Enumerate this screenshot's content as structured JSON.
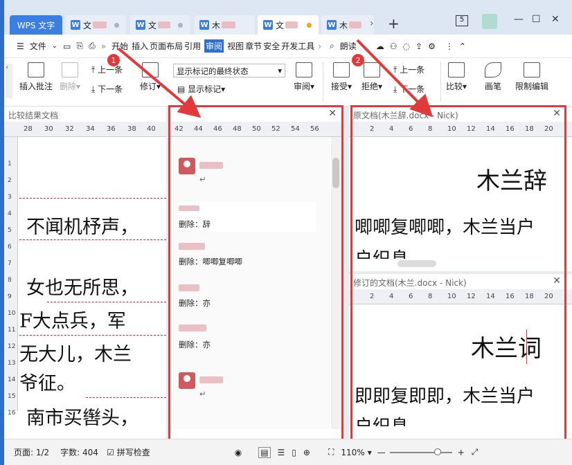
{
  "tabs": {
    "wps": "WPS 文字",
    "doc1": "文",
    "doc2": "文",
    "doc3": "木",
    "doc4": "文",
    "doc5": "木"
  },
  "menu": {
    "file": "文件",
    "items": [
      "开始",
      "插入",
      "页面布局",
      "引用",
      "审阅",
      "视图",
      "章节",
      "安全",
      "开发工具"
    ],
    "selected": "审阅",
    "read_aloud": "朗读"
  },
  "ribbon": {
    "insert_comment": "插入批注",
    "delete": "删除",
    "prev": "上一条",
    "next": "下一条",
    "revise": "修订",
    "show_state": "显示标记的最终状态",
    "show_markup": "显示标记",
    "review": "审阅",
    "accept": "接受",
    "reject": "拒绝",
    "prev2": "上一条",
    "next2": "下一条",
    "compare": "比较",
    "pen": "画笔",
    "restrict": "限制编辑"
  },
  "left_pane": {
    "title": "比较结果文档",
    "ruler": [
      "28",
      "30",
      "32",
      "34",
      "36",
      "38",
      "40"
    ],
    "lines": [
      "不闻机杼声，",
      "女也无所思，",
      "F大点兵，军",
      "无大儿，木兰",
      "爷征。",
      "南市买辔头，"
    ],
    "vruler": [
      "1",
      "2",
      "3",
      "4",
      "5",
      "6",
      "7",
      "8",
      "9",
      "10",
      "11",
      "12",
      "13",
      "14",
      "15",
      "16"
    ]
  },
  "comments": {
    "ruler": [
      "42",
      "44",
      "46",
      "48",
      "50",
      "52",
      "54",
      "56"
    ],
    "items": [
      "删除：辞",
      "删除：唧唧复唧唧",
      "删除：亦",
      "删除：亦"
    ]
  },
  "source_doc": {
    "title": "原文档(木兰辞.docx - Nick)",
    "heading": "木兰辞",
    "line1": "唧唧复唧唧，木兰当户",
    "line2": "户织息",
    "ruler": [
      "2",
      "4",
      "6",
      "8",
      "10",
      "12",
      "14",
      "16",
      "18",
      "20"
    ]
  },
  "revised_doc": {
    "title": "修订的文档(木兰.docx - Nick)",
    "heading": "木兰词",
    "line1": "即即复即即，木兰当户",
    "line2": "户织息",
    "ruler": [
      "2",
      "4",
      "6",
      "8",
      "10",
      "12",
      "14",
      "16",
      "18",
      "20"
    ]
  },
  "status": {
    "page": "页面: 1/2",
    "words": "字数: 404",
    "spell": "拼写检查",
    "zoom": "110%"
  },
  "badges": [
    "1",
    "2"
  ],
  "colors": {
    "accent": "#2d6fd6",
    "highlight": "#e23a3a",
    "wps_blue": "#3c7fe3"
  }
}
